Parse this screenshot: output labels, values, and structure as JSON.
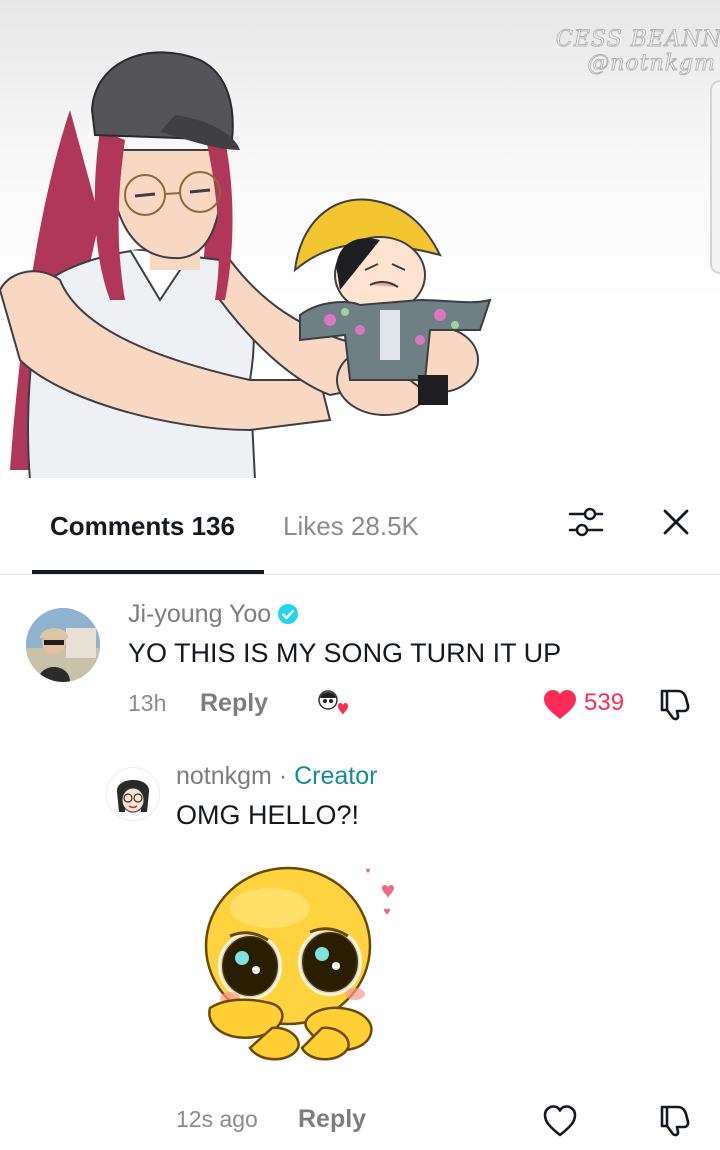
{
  "video": {
    "watermark_line1": "CESS BEANNE",
    "watermark_line2": "@notnkgm"
  },
  "tabs": {
    "comments_label": "Comments 136",
    "likes_label": "Likes 28.5K"
  },
  "icons": {
    "filter": "sliders-icon",
    "close": "close-icon",
    "verified": "verified-badge-icon",
    "like": "heart-icon",
    "dislike": "thumbs-down-icon"
  },
  "colors": {
    "like_red": "#fe2c55",
    "verified_blue": "#20d5ec",
    "creator_teal": "#168a9b"
  },
  "comments": [
    {
      "username": "Ji-young Yoo",
      "text": "YO THIS IS MY SONG TURN IT UP",
      "time": "13h",
      "reply_label": "Reply",
      "likes": "539",
      "liked": true
    }
  ],
  "reply": {
    "username": "notnkgm",
    "separator": " · ",
    "creator_label": "Creator",
    "text": "OMG HELLO?!",
    "time": "12s ago",
    "reply_label": "Reply"
  }
}
